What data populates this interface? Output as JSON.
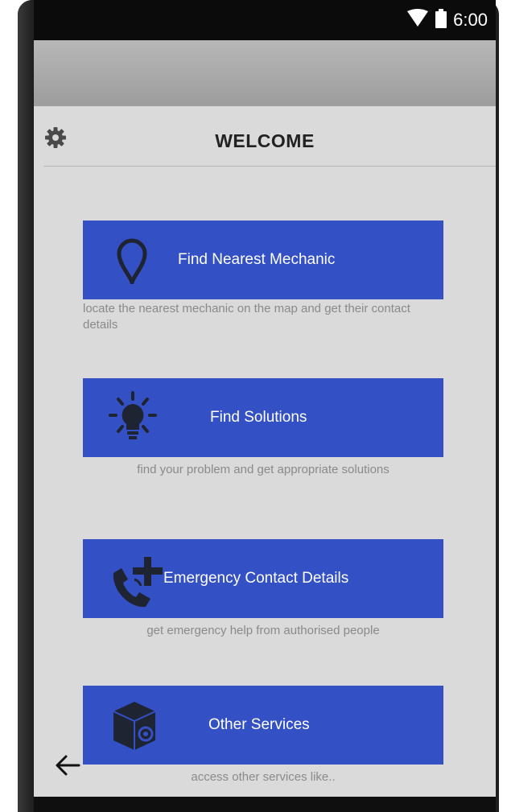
{
  "status_bar": {
    "time": "6:00",
    "icons": [
      "wifi-icon",
      "battery-icon"
    ]
  },
  "header": {
    "title": "WELCOME",
    "settings_icon": "gear-icon"
  },
  "features": [
    {
      "label": "Find Nearest Mechanic",
      "description": "locate the nearest mechanic on the map and get their contact details",
      "icon": "map-pin-icon"
    },
    {
      "label": "Find Solutions",
      "description": "find your problem and get appropriate solutions",
      "icon": "lightbulb-icon"
    },
    {
      "label": "Emergency Contact Details",
      "description": "get emergency help from authorised people",
      "icon": "phone-plus-icon"
    },
    {
      "label": "Other Services",
      "description": "access other services like..",
      "icon": "package-gear-icon"
    }
  ],
  "navigation": {
    "back_icon": "back-arrow-icon"
  },
  "colors": {
    "accent": "#3350c4",
    "background": "#dadada",
    "status_bar": "#0b0b0b",
    "description_text": "#8a8a8a",
    "icon_dark": "#1f2433"
  }
}
